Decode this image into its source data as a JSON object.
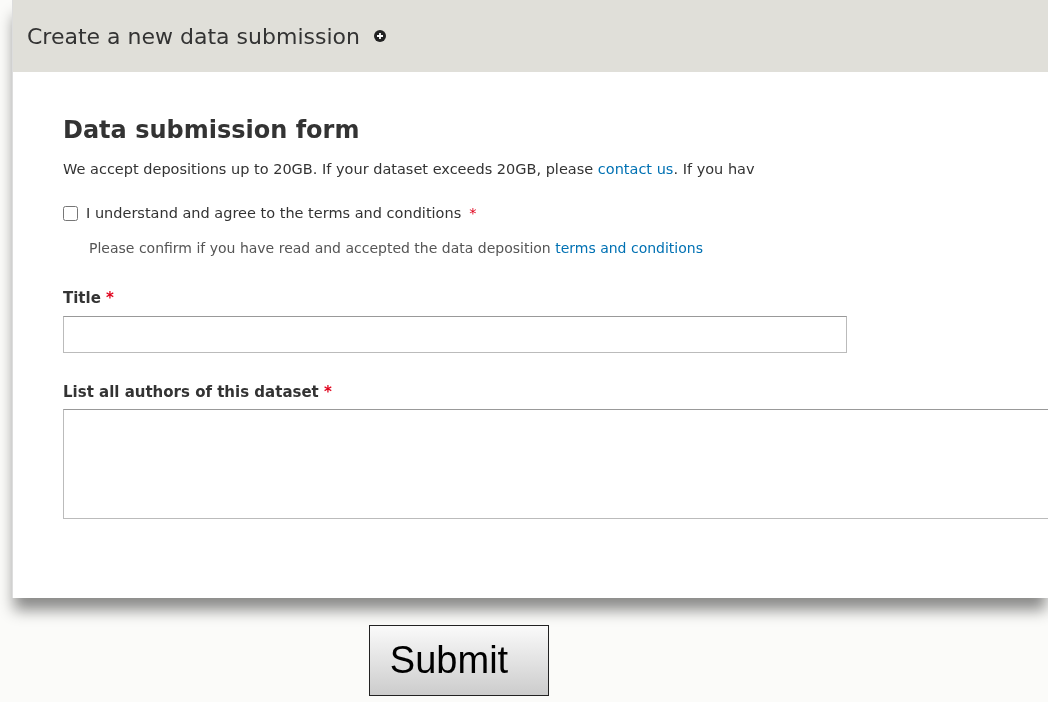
{
  "panel": {
    "title": "Create a new data submission"
  },
  "form": {
    "heading": "Data submission form",
    "intro": {
      "before": "We accept depositions up to 20GB. If your dataset exceeds 20GB, please ",
      "link": "contact us",
      "after": ". If you hav"
    },
    "terms": {
      "label": "I understand and agree to the terms and conditions",
      "required_mark": "*",
      "checked": false,
      "help_before": "Please confirm if you have read and accepted the data deposition ",
      "help_link": "terms and conditions"
    },
    "fields": [
      {
        "kind": "input",
        "label": "Title",
        "required_mark": "*"
      },
      {
        "kind": "textarea",
        "label": "List all authors of this dataset",
        "required_mark": "*"
      }
    ]
  },
  "submit": {
    "label": "Submit"
  }
}
